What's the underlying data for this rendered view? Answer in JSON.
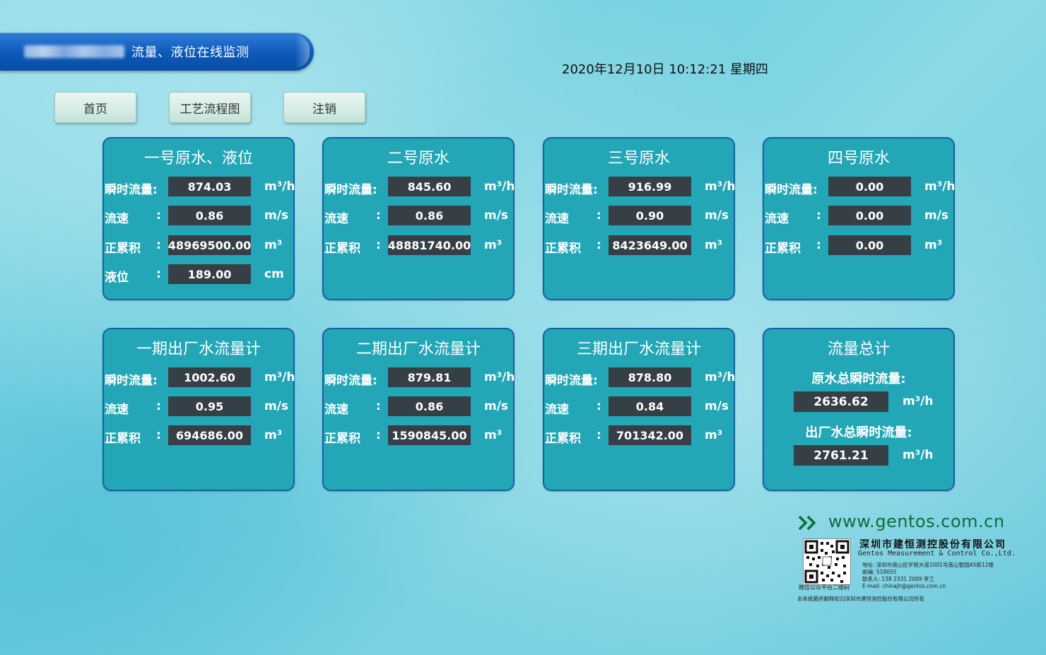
{
  "header": {
    "title": "流量、液位在线监测",
    "datetime": "2020年12月10日 10:12:21 星期四"
  },
  "nav": [
    {
      "label": "首页"
    },
    {
      "label": "工艺流程图"
    },
    {
      "label": "注销"
    }
  ],
  "labels": {
    "flow": "瞬时流量:",
    "speed": "流速",
    "total": "正累积",
    "level": "液位",
    "colon": ":"
  },
  "units": {
    "flow": "m³/h",
    "speed": "m/s",
    "total": "m³",
    "level": "cm"
  },
  "panels": [
    {
      "title": "一号原水、液位",
      "flow": "874.03",
      "speed": "0.86",
      "total": "48969500.00",
      "level": "189.00"
    },
    {
      "title": "二号原水",
      "flow": "845.60",
      "speed": "0.86",
      "total": "48881740.00"
    },
    {
      "title": "三号原水",
      "flow": "916.99",
      "speed": "0.90",
      "total": "8423649.00"
    },
    {
      "title": "四号原水",
      "flow": "0.00",
      "speed": "0.00",
      "total": "0.00"
    },
    {
      "title": "一期出厂水流量计",
      "flow": "1002.60",
      "speed": "0.95",
      "total": "694686.00"
    },
    {
      "title": "二期出厂水流量计",
      "flow": "879.81",
      "speed": "0.86",
      "total": "1590845.00"
    },
    {
      "title": "三期出厂水流量计",
      "flow": "878.80",
      "speed": "0.84",
      "total": "701342.00"
    }
  ],
  "summary": {
    "title": "流量总计",
    "raw_label": "原水总瞬时流量:",
    "raw_value": "2636.62",
    "out_label": "出厂水总瞬时流量:",
    "out_value": "2761.21",
    "unit": "m³/h"
  },
  "footer": {
    "url": "www.gentos.com.cn",
    "company": "深圳市建恒测控股份有限公司",
    "company_en": "Gentos Measurement & Control Co.,Ltd.",
    "address": "地址: 深圳市南山区学苑大道1001号南山智园A5栋12楼",
    "postcode": "邮编:    518055",
    "contact": "联系人: 138 2331 2009 李工",
    "email": "E-mail: chinajh@gentos.com.cn",
    "qr_caption": "微信公众平台二维码",
    "copyright": "本系统最终解释权归深圳市建恒测控股份有限公司所有"
  },
  "colors": {
    "panel_bg": "#23a6b6",
    "panel_border": "#1561a8",
    "value_bg": "#363f46",
    "banner": "#0d58b8",
    "url_green": "#0c6f3a"
  }
}
